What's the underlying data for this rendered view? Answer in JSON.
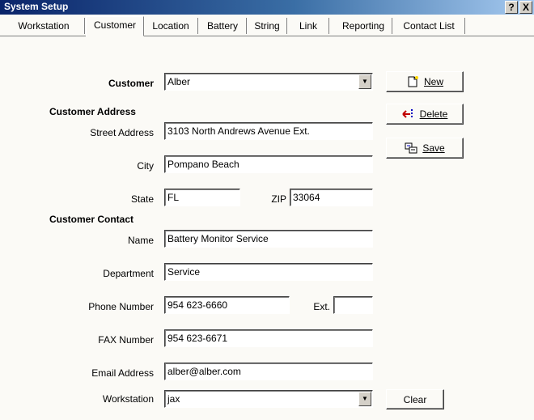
{
  "window": {
    "title": "System Setup",
    "help_label": "?",
    "close_label": "X"
  },
  "tabs": [
    {
      "label": "Workstation"
    },
    {
      "label": "Customer"
    },
    {
      "label": "Location"
    },
    {
      "label": "Battery"
    },
    {
      "label": "String"
    },
    {
      "label": "Link"
    },
    {
      "label": "Reporting"
    },
    {
      "label": "Contact List"
    }
  ],
  "form": {
    "customer": {
      "label": "Customer",
      "value": "Alber"
    },
    "address_section": "Customer Address",
    "street": {
      "label": "Street Address",
      "value": "3103 North Andrews Avenue Ext."
    },
    "city": {
      "label": "City",
      "value": "Pompano Beach"
    },
    "state": {
      "label": "State",
      "value": "FL"
    },
    "zip": {
      "label": "ZIP",
      "value": "33064"
    },
    "contact_section": "Customer Contact",
    "name": {
      "label": "Name",
      "value": "Battery Monitor Service"
    },
    "department": {
      "label": "Department",
      "value": "Service"
    },
    "phone": {
      "label": "Phone Number",
      "value": "954 623-6660"
    },
    "ext": {
      "label": "Ext.",
      "value": ""
    },
    "fax": {
      "label": "FAX Number",
      "value": "954 623-6671"
    },
    "email": {
      "label": "Email Address",
      "value": "alber@alber.com"
    },
    "workstation": {
      "label": "Workstation",
      "value": "jax"
    }
  },
  "buttons": {
    "new": "New",
    "delete": "Delete",
    "save": "Save",
    "clear": "Clear"
  }
}
